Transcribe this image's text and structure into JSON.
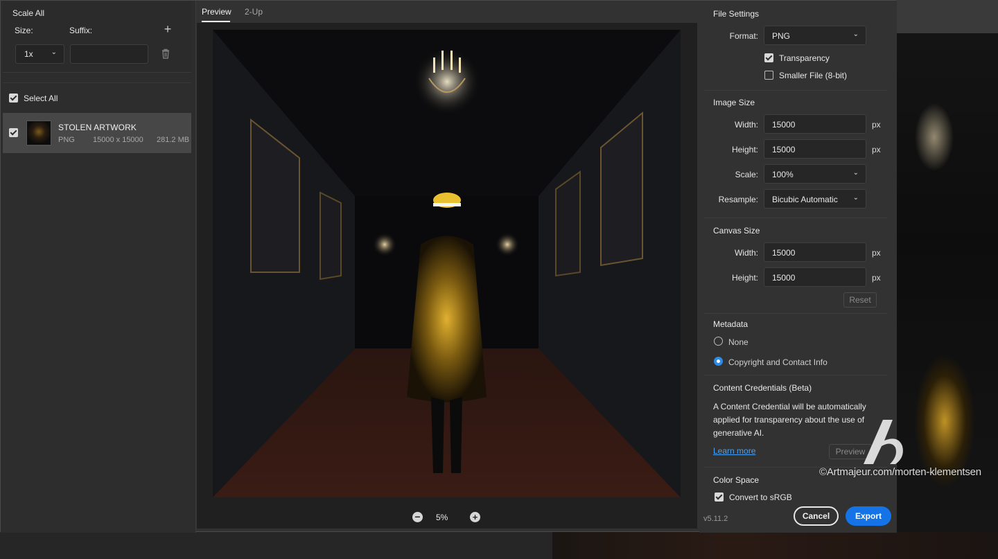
{
  "scale_panel": {
    "title": "Scale All",
    "size_label": "Size:",
    "suffix_label": "Suffix:",
    "size_value": "1x",
    "suffix_value": ""
  },
  "assets": {
    "select_all_label": "Select All",
    "items": [
      {
        "name": "STOLEN ARTWORK",
        "format": "PNG",
        "dimensions": "15000 x 15000",
        "file_size": "281.2 MB",
        "checked": true
      }
    ]
  },
  "tabs": [
    {
      "label": "Preview",
      "active": true
    },
    {
      "label": "2-Up",
      "active": false
    }
  ],
  "zoom": {
    "value": "5%"
  },
  "file_settings": {
    "title": "File Settings",
    "format_label": "Format:",
    "format_value": "PNG",
    "transparency_label": "Transparency",
    "transparency_checked": true,
    "smaller_file_label": "Smaller File (8-bit)",
    "smaller_file_checked": false
  },
  "image_size": {
    "title": "Image Size",
    "width_label": "Width:",
    "width_value": "15000",
    "height_label": "Height:",
    "height_value": "15000",
    "scale_label": "Scale:",
    "scale_value": "100%",
    "resample_label": "Resample:",
    "resample_value": "Bicubic Automatic",
    "unit": "px"
  },
  "canvas_size": {
    "title": "Canvas Size",
    "width_label": "Width:",
    "width_value": "15000",
    "height_label": "Height:",
    "height_value": "15000",
    "unit": "px",
    "reset_label": "Reset"
  },
  "metadata": {
    "title": "Metadata",
    "option_none": "None",
    "option_copyright": "Copyright and Contact Info",
    "selected": "Copyright and Contact Info"
  },
  "content_credentials": {
    "title": "Content Credentials (Beta)",
    "line1": "A Content Credential will be automatically",
    "line2": "applied for transparency about the use of",
    "line3": "generative AI.",
    "learn_more": "Learn more",
    "preview_label": "Preview"
  },
  "color_space": {
    "title": "Color Space",
    "convert_label": "Convert to sRGB",
    "convert_checked": true
  },
  "footer": {
    "version": "v5.11.2",
    "cancel_label": "Cancel",
    "export_label": "Export"
  },
  "watermark": {
    "text": "©Artmajeur.com/morten-klementsen"
  },
  "colors": {
    "accent": "#1473e6",
    "panel": "#323232",
    "link": "#4ba0f0"
  }
}
